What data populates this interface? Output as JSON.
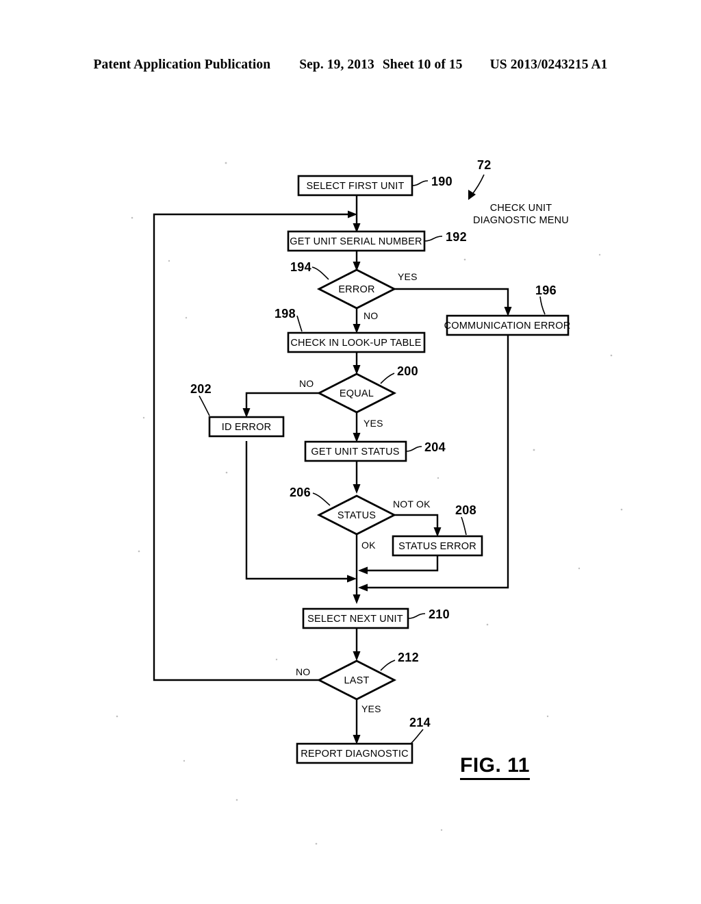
{
  "header": {
    "publication": "Patent Application Publication",
    "date": "Sep. 19, 2013",
    "sheet": "Sheet 10 of 15",
    "patent_number": "US 2013/0243215 A1"
  },
  "figure": {
    "label": "FIG. 11",
    "title_annotation": "CHECK UNIT",
    "title_annotation_line2": "DIAGNOSTIC MENU",
    "title_ref": "72"
  },
  "flowchart": {
    "nodes": [
      {
        "id": "select_first_unit",
        "type": "process",
        "label": "SELECT FIRST UNIT",
        "ref": "190"
      },
      {
        "id": "get_unit_serial",
        "type": "process",
        "label": "GET UNIT SERIAL NUMBER",
        "ref": "192"
      },
      {
        "id": "error",
        "type": "decision",
        "label": "ERROR",
        "ref": "194"
      },
      {
        "id": "communication_error",
        "type": "process",
        "label": "COMMUNICATION ERROR",
        "ref": "196"
      },
      {
        "id": "check_lookup_table",
        "type": "process",
        "label": "CHECK IN LOOK-UP TABLE",
        "ref": "198"
      },
      {
        "id": "equal",
        "type": "decision",
        "label": "EQUAL",
        "ref": "200"
      },
      {
        "id": "id_error",
        "type": "process",
        "label": "ID ERROR",
        "ref": "202"
      },
      {
        "id": "get_unit_status",
        "type": "process",
        "label": "GET UNIT STATUS",
        "ref": "204"
      },
      {
        "id": "status",
        "type": "decision",
        "label": "STATUS",
        "ref": "206"
      },
      {
        "id": "status_error",
        "type": "process",
        "label": "STATUS ERROR",
        "ref": "208"
      },
      {
        "id": "select_next_unit",
        "type": "process",
        "label": "SELECT NEXT UNIT",
        "ref": "210"
      },
      {
        "id": "last",
        "type": "decision",
        "label": "LAST",
        "ref": "212"
      },
      {
        "id": "report_diagnostic",
        "type": "process",
        "label": "REPORT DIAGNOSTIC",
        "ref": "214"
      }
    ],
    "branch_labels": {
      "error_yes": "YES",
      "error_no": "NO",
      "equal_no": "NO",
      "equal_yes": "YES",
      "status_not_ok": "NOT OK",
      "status_ok": "OK",
      "last_no": "NO",
      "last_yes": "YES"
    }
  },
  "colors": {
    "ink": "#000000",
    "paper": "#ffffff"
  }
}
